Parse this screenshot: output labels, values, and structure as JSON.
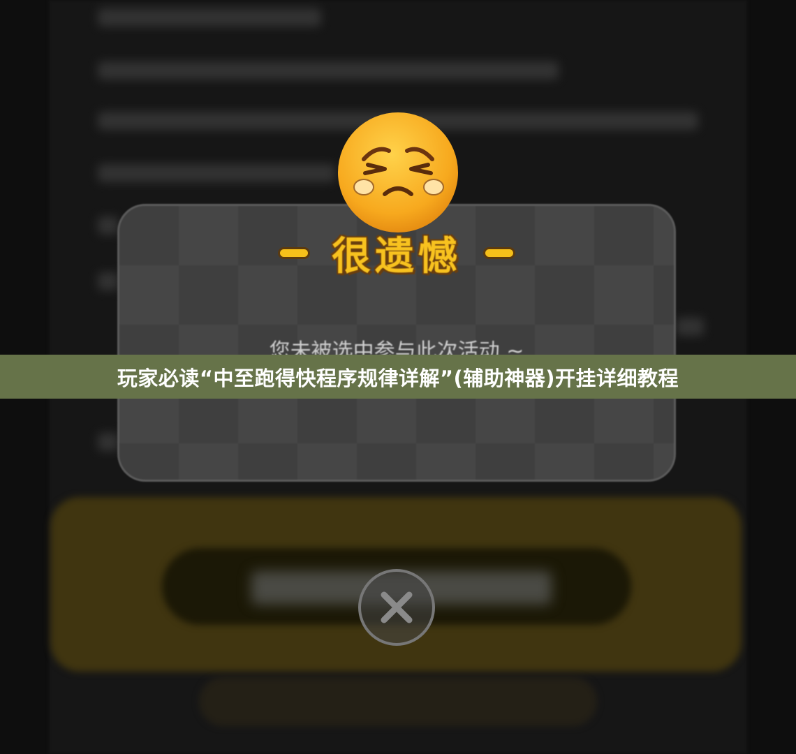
{
  "dialog": {
    "title": "很遗憾",
    "message": "您未被选中参与此次活动 ~",
    "close_icon": "close-icon",
    "emoji_icon": "sad-face-emoji-icon"
  },
  "banner": {
    "text": "玩家必读“中至跑得快程序规律详解”(辅助神器)开挂详细教程"
  },
  "colors": {
    "title_yellow": "#f8c21f",
    "banner_green": "#667349",
    "dialog_gray": "#3f3f3f"
  }
}
